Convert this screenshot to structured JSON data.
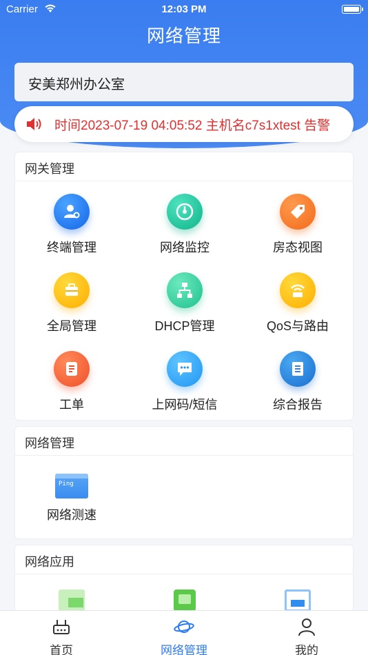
{
  "status_bar": {
    "carrier": "Carrier",
    "time": "12:03 PM"
  },
  "nav": {
    "title": "网络管理"
  },
  "site_selector": {
    "value": "安美郑州办公室"
  },
  "notice": {
    "text": "时间2023-07-19 04:05:52 主机名c7s1xtest 告警"
  },
  "gateway_section": {
    "title": "网关管理",
    "items": [
      {
        "label": "终端管理",
        "icon": "terminal-user-icon",
        "color": "#1566e8"
      },
      {
        "label": "网络监控",
        "icon": "monitor-gauge-icon",
        "color": "#10b48a"
      },
      {
        "label": "房态视图",
        "icon": "tag-icon",
        "color": "#f26a1b"
      },
      {
        "label": "全局管理",
        "icon": "toolbox-icon",
        "color": "#ffae00"
      },
      {
        "label": "DHCP管理",
        "icon": "network-tree-icon",
        "color": "#20c08c"
      },
      {
        "label": "QoS与路由",
        "icon": "router-wifi-icon",
        "color": "#ffae00"
      },
      {
        "label": "工单",
        "icon": "document-list-icon",
        "color": "#f0502a"
      },
      {
        "label": "上网码/短信",
        "icon": "chat-message-icon",
        "color": "#2196f3"
      },
      {
        "label": "综合报告",
        "icon": "report-icon",
        "color": "#1a6fd0"
      }
    ]
  },
  "network_section": {
    "title": "网络管理",
    "items": [
      {
        "label": "网络测速",
        "icon": "ping-window-icon",
        "badge_text": "Ping"
      }
    ]
  },
  "apps_section": {
    "title": "网络应用",
    "items": [
      {
        "icon": "app-list-icon",
        "color": "#7bd86a"
      },
      {
        "icon": "app-square-icon",
        "color": "#5cc94a"
      },
      {
        "icon": "scan-icon",
        "color": "#2f8ef0"
      }
    ]
  },
  "tabbar": {
    "tabs": [
      {
        "label": "首页",
        "icon": "router-icon",
        "active": false
      },
      {
        "label": "网络管理",
        "icon": "planet-icon",
        "active": true
      },
      {
        "label": "我的",
        "icon": "person-icon",
        "active": false
      }
    ],
    "active_color": "#2f7bf0"
  }
}
